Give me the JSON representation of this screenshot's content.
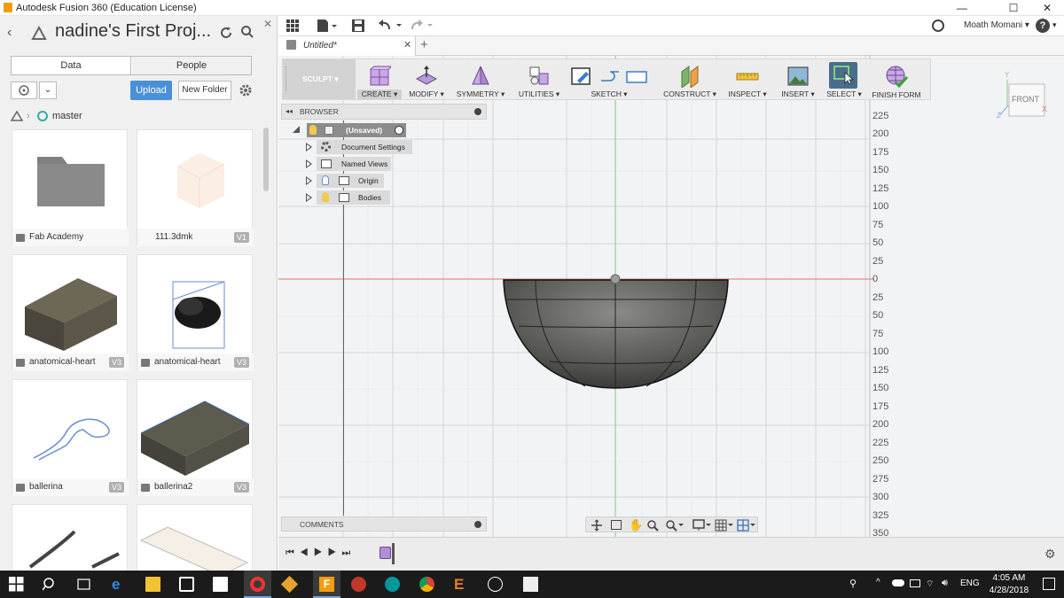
{
  "window": {
    "title": "Autodesk Fusion 360 (Education License)",
    "minimize": "—",
    "maximize": "☐",
    "close": "✕"
  },
  "data_panel": {
    "project_title": "nadine's First Proj...",
    "tabs": [
      "Data",
      "People"
    ],
    "upload_label": "Upload",
    "new_folder_label": "New Folder",
    "breadcrumb": "master",
    "items": [
      {
        "name": "Fab Academy",
        "version": "",
        "kind": "folder"
      },
      {
        "name": "111.3dmk",
        "version": "V1",
        "kind": "file"
      },
      {
        "name": "anatomical-heart",
        "version": "V3",
        "kind": "box"
      },
      {
        "name": "anatomical-heart",
        "version": "V3",
        "kind": "heart"
      },
      {
        "name": "ballerina",
        "version": "V3",
        "kind": "ballerina"
      },
      {
        "name": "ballerina2",
        "version": "V3",
        "kind": "box2"
      }
    ]
  },
  "header": {
    "user_name": "Moath Momani ▾",
    "help": "?",
    "doc_tab": "Untitled*",
    "doc_tab_close": "✕",
    "new_tab": "+"
  },
  "toolbar": {
    "workspace": "SCULPT ▾",
    "groups": [
      "CREATE ▾",
      "MODIFY ▾",
      "SYMMETRY ▾",
      "UTILITIES ▾",
      "SKETCH ▾",
      "CONSTRUCT ▾",
      "INSPECT ▾",
      "INSERT ▾",
      "SELECT ▾",
      "FINISH FORM"
    ]
  },
  "browser": {
    "title": "BROWSER",
    "collapse": "◂◂",
    "root": "(Unsaved)",
    "nodes": [
      "Document Settings",
      "Named Views",
      "Origin",
      "Bodies"
    ]
  },
  "comments": {
    "title": "COMMENTS"
  },
  "viewcube": {
    "face": "FRONT",
    "axis_x": "X",
    "axis_y": "Y",
    "axis_z": "Z"
  },
  "ruler": {
    "labels": [
      "225",
      "200",
      "175",
      "150",
      "125",
      "100",
      "75",
      "50",
      "25",
      "0",
      "25",
      "50",
      "75",
      "100",
      "125",
      "150",
      "175",
      "200",
      "225",
      "250",
      "275",
      "300",
      "325",
      "350"
    ]
  },
  "taskbar": {
    "language": "ENG",
    "time": "4:05 AM",
    "date": "4/28/2018"
  },
  "colors": {
    "accent": "#4a90d9",
    "select_active": "#4a6d8c",
    "axis_red": "#e06060",
    "axis_green": "#60c060"
  }
}
